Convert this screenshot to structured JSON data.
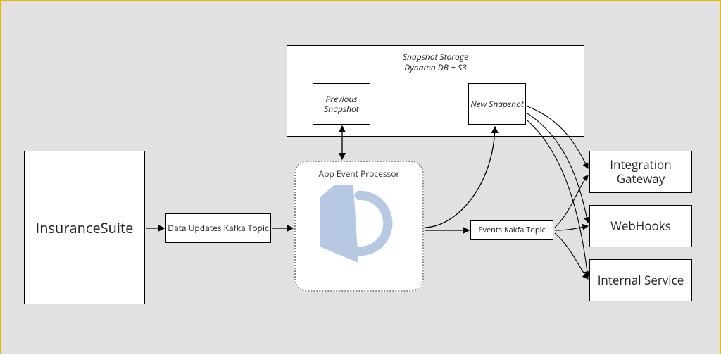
{
  "nodes": {
    "insurance_suite": "InsuranceSuite",
    "data_updates_topic": "Data Updates Kafka Topic",
    "app_event_processor": "App Event Processor",
    "snapshot_storage_title_line1": "Snapshot Storage",
    "snapshot_storage_title_line2": "Dynamo DB + S3",
    "previous_snapshot": "Previous Snapshot",
    "new_snapshot": "New Snapshot",
    "events_topic": "Events Kakfa Topic",
    "integration_gateway": "Integration Gateway",
    "webhooks": "WebHooks",
    "internal_service": "Internal Service"
  },
  "icons": {
    "refresh": "refresh-cycle-icon"
  },
  "colors": {
    "frame_border": "#e5b700",
    "canvas_bg": "#e1e1e1",
    "box_bg": "#ffffff",
    "box_border": "#000000",
    "icon_color": "#b6c8e2"
  }
}
